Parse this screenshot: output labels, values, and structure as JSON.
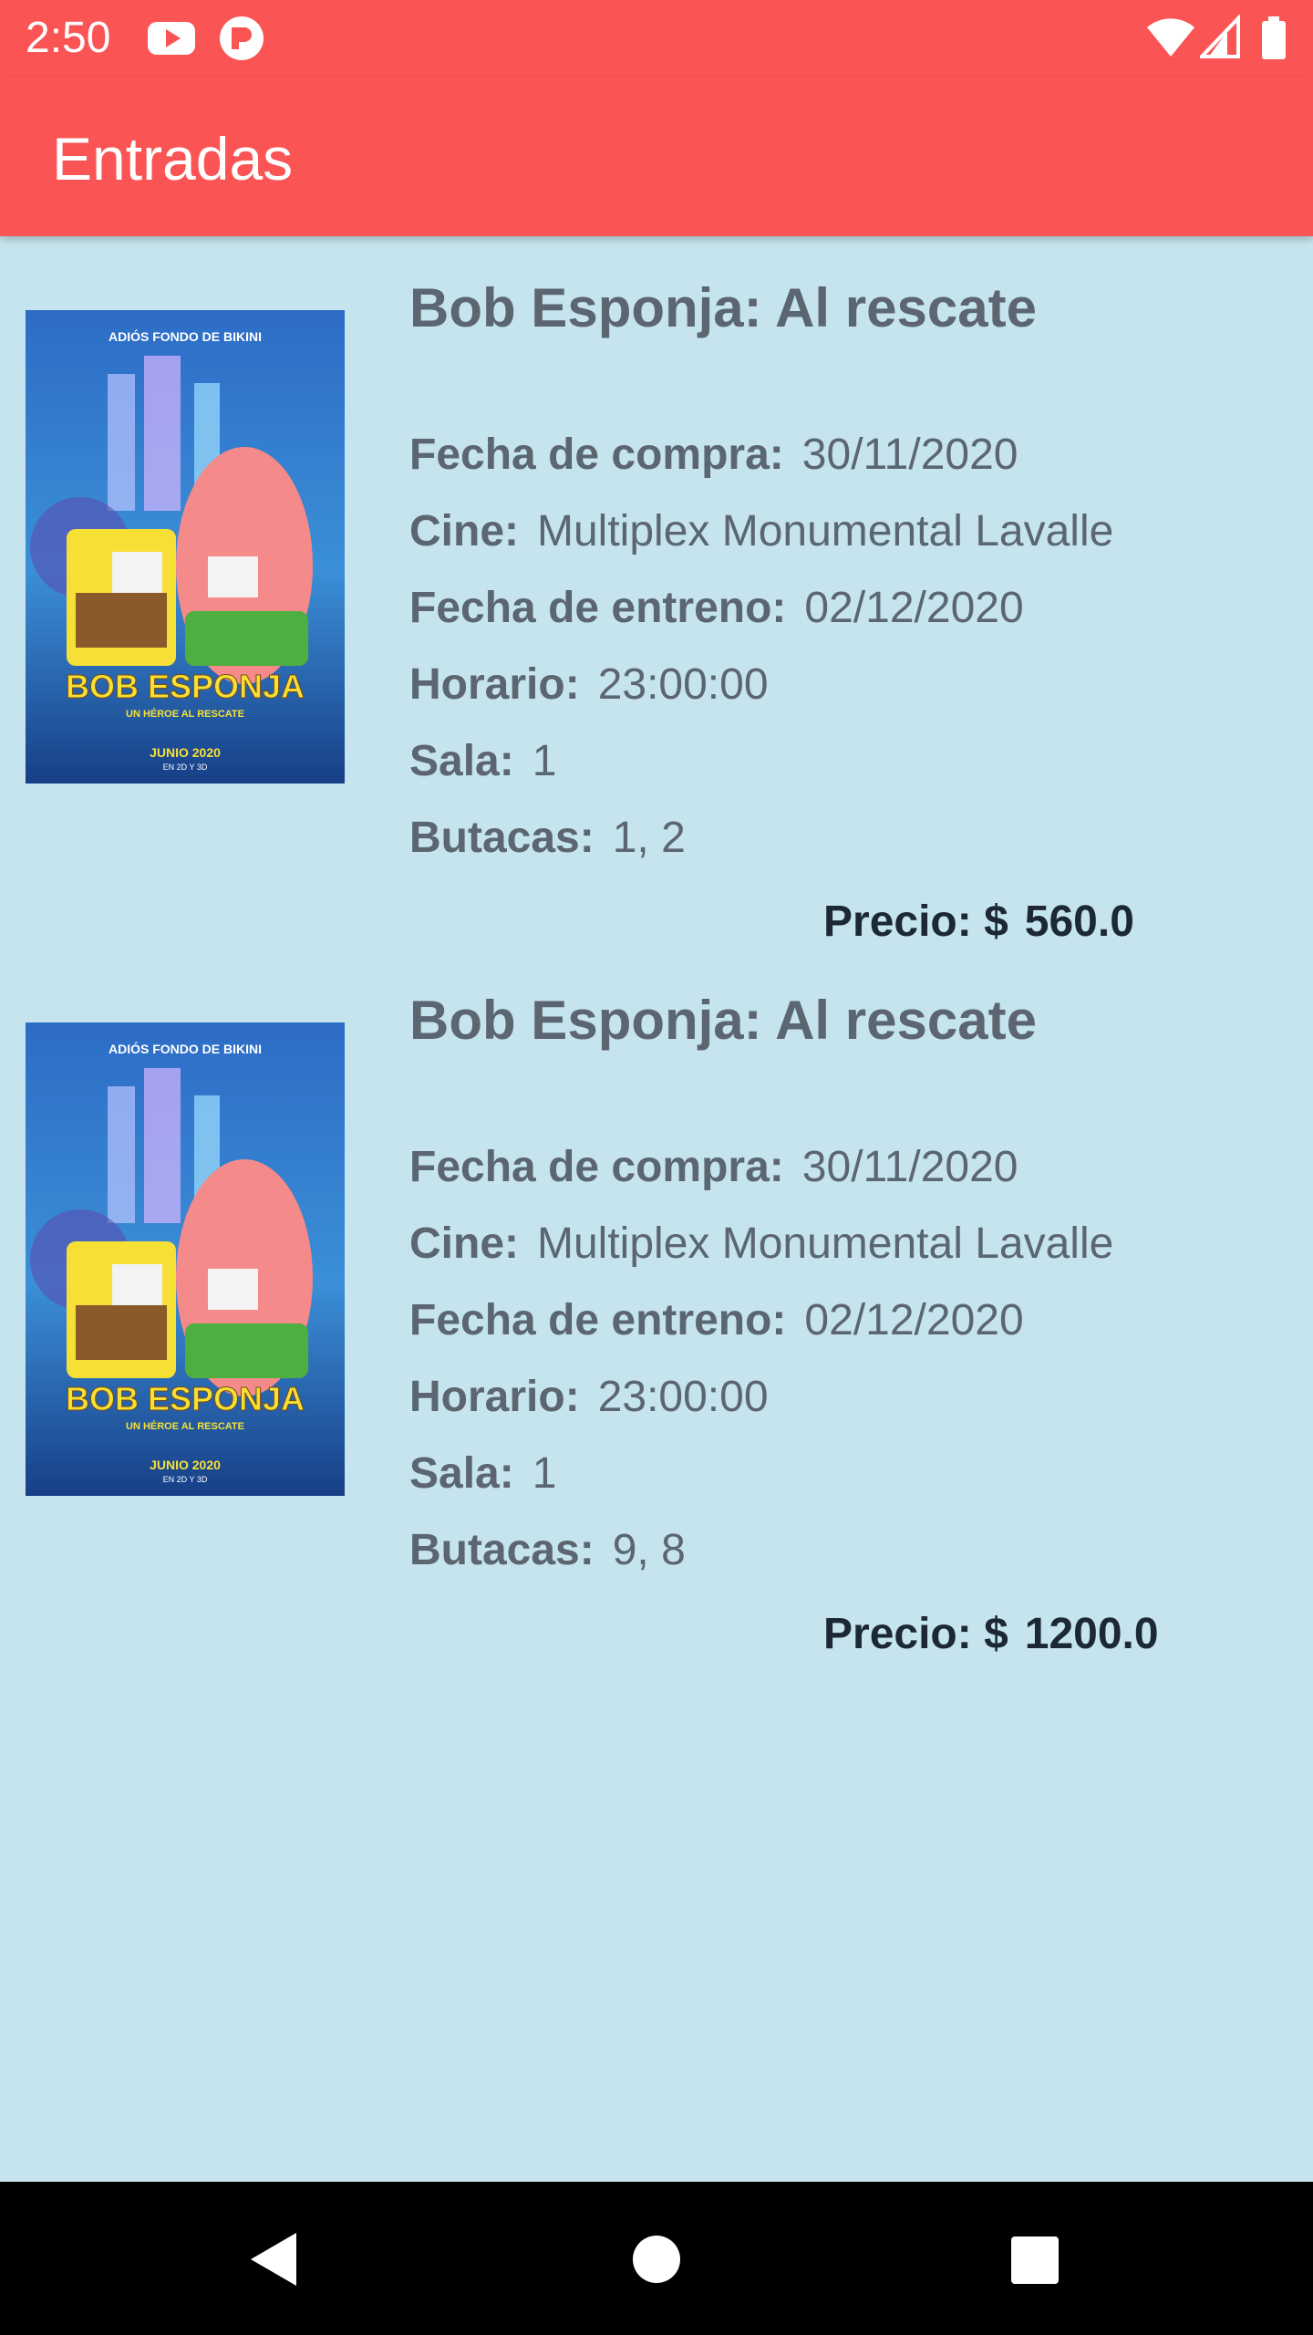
{
  "status_bar": {
    "time": "2:50",
    "icons": [
      "youtube-icon",
      "notification-app-icon",
      "wifi-icon",
      "cell-signal-icon",
      "battery-icon"
    ]
  },
  "app_bar": {
    "title": "Entradas"
  },
  "colors": {
    "accent": "#fb5454",
    "background": "#c5e4ed",
    "text": "#5b6670",
    "price_text": "#1c2833"
  },
  "labels": {
    "fecha_compra": "Fecha de compra:",
    "cine": "Cine:",
    "fecha_estreno": "Fecha de entreno:",
    "horario": "Horario:",
    "sala": "Sala:",
    "butacas": "Butacas:",
    "precio": "Precio: $"
  },
  "tickets": [
    {
      "title": "Bob Esponja: Al rescate",
      "poster": {
        "top_text": "ADIÓS FONDO DE BIKINI",
        "logo_text": "BOB ESPONJA",
        "subtitle_text": "UN HÉROE AL RESCATE",
        "date_text": "JUNIO 2020",
        "format_text": "EN 2D Y 3D"
      },
      "fecha_compra": "30/11/2020",
      "cine": "Multiplex Monumental Lavalle",
      "fecha_estreno": "02/12/2020",
      "horario": "23:00:00",
      "sala": "1",
      "butacas": "1, 2",
      "precio": "560.0"
    },
    {
      "title": "Bob Esponja: Al rescate",
      "poster": {
        "top_text": "ADIÓS FONDO DE BIKINI",
        "logo_text": "BOB ESPONJA",
        "subtitle_text": "UN HÉROE AL RESCATE",
        "date_text": "JUNIO 2020",
        "format_text": "EN 2D Y 3D"
      },
      "fecha_compra": "30/11/2020",
      "cine": "Multiplex Monumental Lavalle",
      "fecha_estreno": "02/12/2020",
      "horario": "23:00:00",
      "sala": "1",
      "butacas": "9, 8",
      "precio": "1200.0"
    }
  ],
  "nav_bar": {
    "buttons": [
      "back-icon",
      "home-icon",
      "recents-icon"
    ]
  }
}
